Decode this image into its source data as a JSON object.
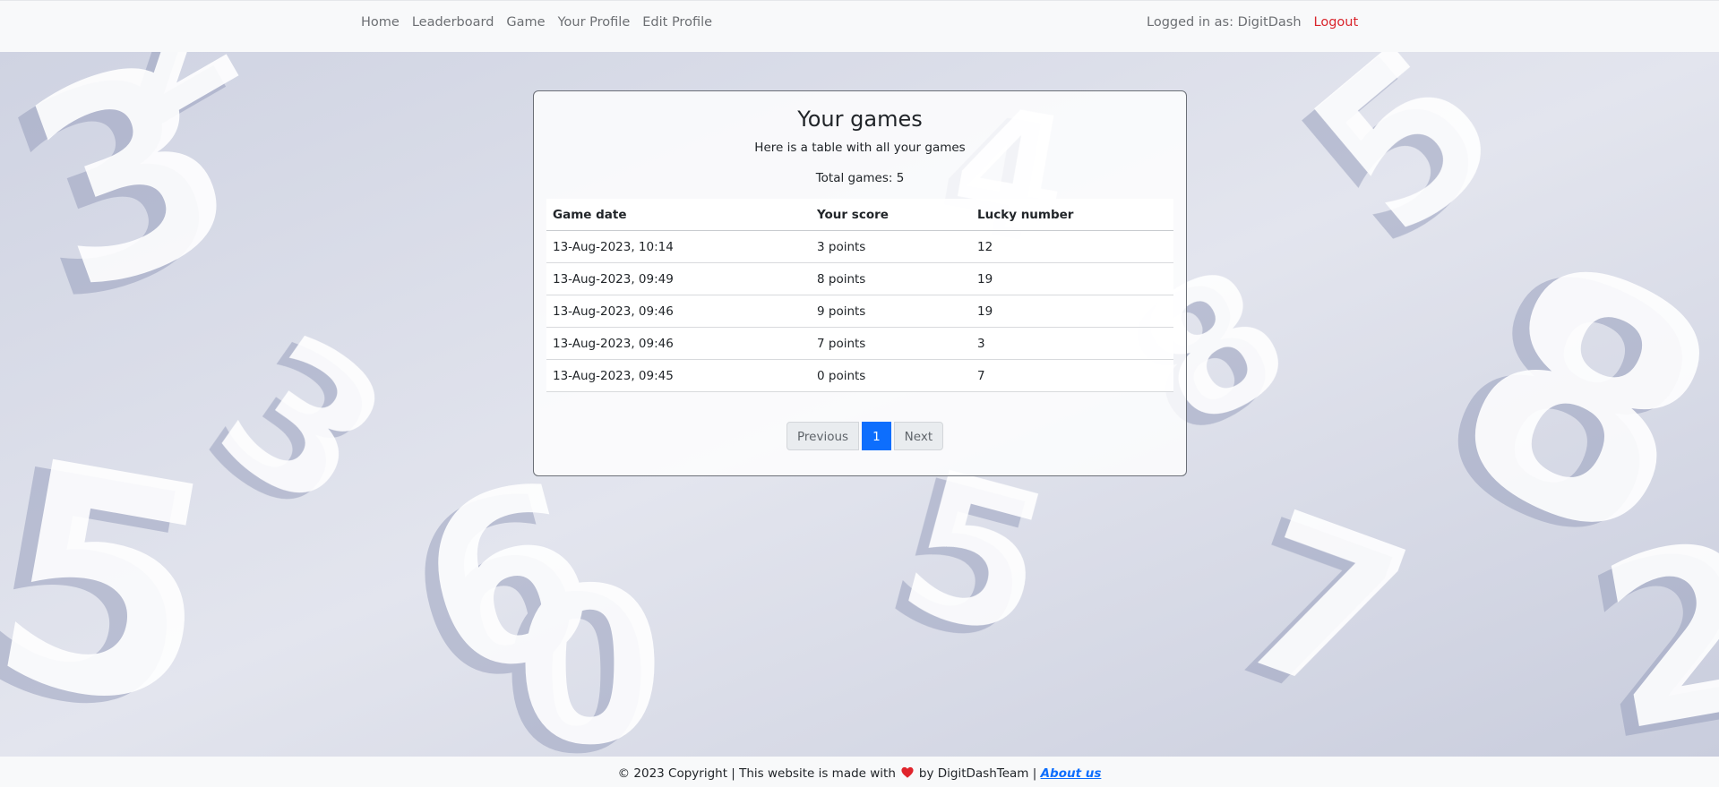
{
  "nav": {
    "links": [
      "Home",
      "Leaderboard",
      "Game",
      "Your Profile",
      "Edit Profile"
    ],
    "logged_in_text": "Logged in as: DigitDash",
    "logout_label": "Logout"
  },
  "card": {
    "title": "Your games",
    "subtitle": "Here is a table with all your games",
    "total_games": "Total games: 5"
  },
  "table": {
    "headers": [
      "Game date",
      "Your score",
      "Lucky number"
    ],
    "rows": [
      [
        "13-Aug-2023, 10:14",
        "3 points",
        "12"
      ],
      [
        "13-Aug-2023, 09:49",
        "8 points",
        "19"
      ],
      [
        "13-Aug-2023, 09:46",
        "9 points",
        "19"
      ],
      [
        "13-Aug-2023, 09:46",
        "7 points",
        "3"
      ],
      [
        "13-Aug-2023, 09:45",
        "0 points",
        "7"
      ]
    ]
  },
  "pagination": {
    "previous_label": "Previous",
    "current_page": "1",
    "next_label": "Next"
  },
  "footer": {
    "text_before": "© 2023 Copyright | This website is made with",
    "text_after": "by DigitDashTeam |",
    "about_label": "About us"
  },
  "colors": {
    "accent": "#0d6efd",
    "logout": "#d9252c",
    "heart": "#e0242c"
  }
}
